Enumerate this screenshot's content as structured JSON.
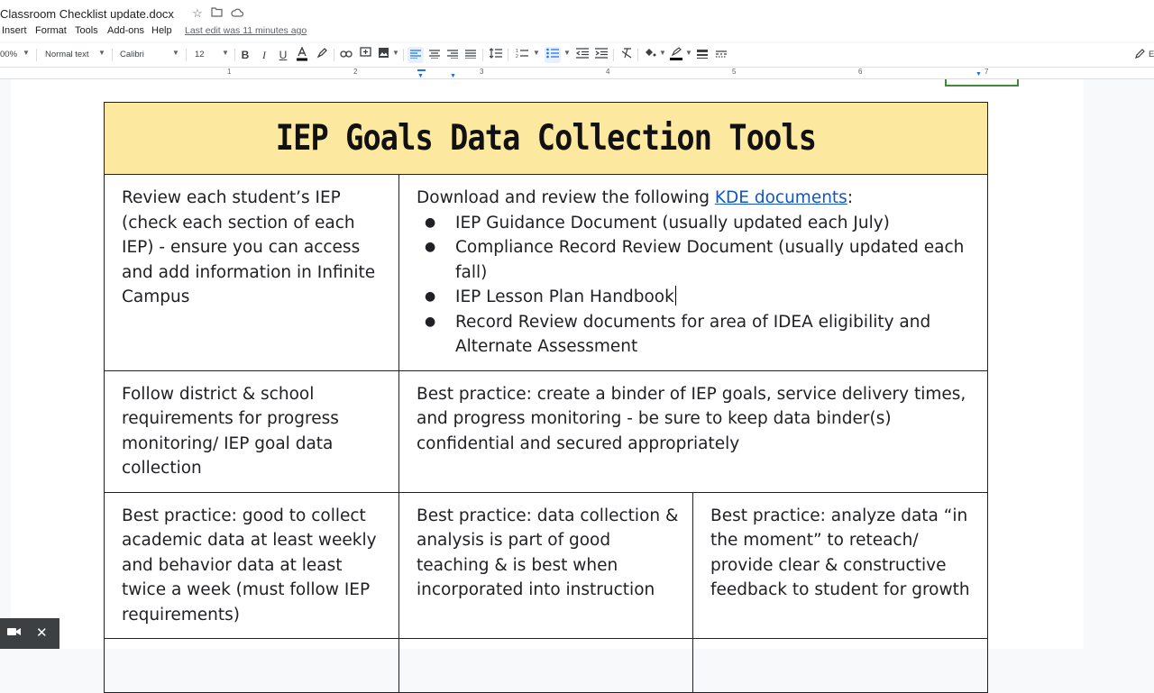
{
  "doc": {
    "title": "Classroom Checklist update.docx",
    "last_edit": "Last edit was 11 minutes ago"
  },
  "menu": {
    "items": [
      "Insert",
      "Format",
      "Tools",
      "Add-ons",
      "Help"
    ]
  },
  "toolbar": {
    "zoom": "00%",
    "style": "Normal text",
    "font": "Calibri",
    "size": "12",
    "edit_mode": "E"
  },
  "ruler": {
    "numbers": [
      "1",
      "2",
      "3",
      "4",
      "5",
      "6",
      "7"
    ]
  },
  "table": {
    "header": "IEP Goals Data Collection Tools",
    "row1": {
      "left": "Review each student’s IEP (check each section of each IEP) - ensure you can access and add information in Infinite Campus",
      "right_intro": "Download and review the following ",
      "right_link": "KDE documents",
      "right_colon": ":",
      "bullets": [
        "IEP Guidance Document (usually updated each July)",
        "Compliance Record Review Document (usually updated each fall)",
        "IEP Lesson Plan Handbook",
        "Record Review documents for area of IDEA eligibility and Alternate Assessment"
      ]
    },
    "row2": {
      "left": "Follow district & school requirements for progress monitoring/ IEP goal data collection",
      "right": "Best practice: create a binder of IEP goals, service delivery times, and progress monitoring - be sure to keep data binder(s) confidential and secured appropriately"
    },
    "row3": {
      "col1": "Best practice: good to collect academic data at least weekly and behavior data at least twice a week (must follow IEP requirements)",
      "col2": "Best practice: data collection & analysis is part of good teaching & is best when incorporated into instruction",
      "col3": "Best practice: analyze data “in the moment” to reteach/ provide clear & constructive feedback to student for growth"
    }
  },
  "colors": {
    "header_bg": "#fce89f",
    "link": "#1155cc",
    "accent": "#1a73e8"
  }
}
